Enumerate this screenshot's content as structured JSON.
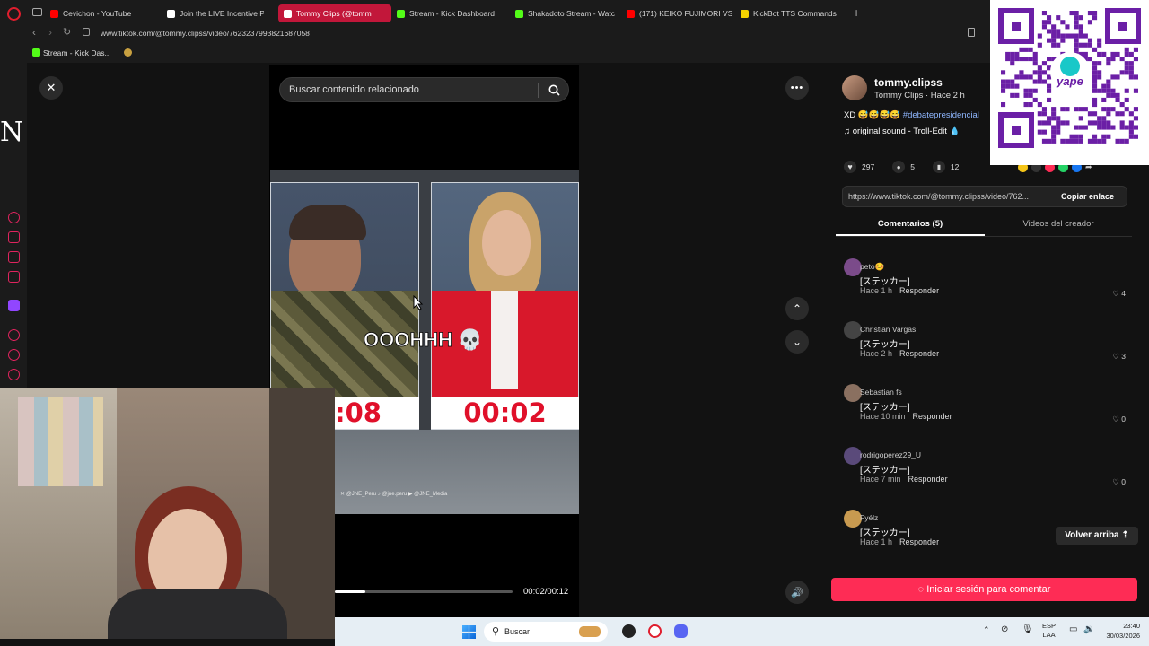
{
  "tabs": [
    {
      "label": "Cevichon - YouTube",
      "fav": "youtube-icon",
      "color": "#ff0000"
    },
    {
      "label": "Join the LIVE Incentive Pr",
      "fav": "tiktok-icon",
      "color": "#ffffff"
    },
    {
      "label": "Tommy Clips (@tomm",
      "fav": "tiktok-icon",
      "color": "#ffffff",
      "active": true
    },
    {
      "label": "Stream - Kick Dashboard",
      "fav": "kick-icon",
      "color": "#53fc18"
    },
    {
      "label": "Shakadoto Stream - Watc",
      "fav": "kick-icon",
      "color": "#53fc18"
    },
    {
      "label": "(171) KEIKO FUJIMORI VS",
      "fav": "youtube-icon",
      "color": "#ff0000"
    },
    {
      "label": "KickBot TTS Commands",
      "fav": "kickbot-icon",
      "color": "#f5d300"
    }
  ],
  "address": {
    "url": "www.tiktok.com/@tommy.clipss/video/7623237993821687058"
  },
  "bookmarks": {
    "item1": "Stream - Kick Das..."
  },
  "search": {
    "placeholder": "Buscar contenido relacionado"
  },
  "video": {
    "caption": "OOOHHH 💀",
    "timer_left": ":08",
    "timer_right": "00:02",
    "time_display": "00:02/00:12",
    "progress": 0.17,
    "footer": "✕ @JNE_Peru   ♪ @jne.peru   ▶ @JNE_Media"
  },
  "sidebar_letter": "N",
  "author": {
    "handle": "tommy.clipss",
    "subtitle": "Tommy Clips · Hace 2 h",
    "caption_prefix": "XD 😅😅😅😅",
    "hashtag": "#debatepresidencial",
    "sound": "original sound - Troll-Edit 💧"
  },
  "stats": {
    "likes": "297",
    "comments": "5",
    "saves": "12"
  },
  "link": {
    "url": "https://www.tiktok.com/@tommy.clipss/video/762...",
    "copy_label": "Copiar enlace"
  },
  "tabs_panel": {
    "comments": "Comentarios (5)",
    "creator": "Videos del creador"
  },
  "comments": [
    {
      "user": "peto🤒",
      "text": "[ステッカー]",
      "time": "Hace 1 h",
      "reply": "Responder",
      "likes": "4",
      "avatar": "#7b4b8a"
    },
    {
      "user": "Christian Vargas",
      "text": "[ステッカー]",
      "time": "Hace 2 h",
      "reply": "Responder",
      "likes": "3",
      "avatar": "#444444"
    },
    {
      "user": "Sebastian fs",
      "text": "[ステッカー]",
      "time": "Hace 10 min",
      "reply": "Responder",
      "likes": "0",
      "avatar": "#8a7060"
    },
    {
      "user": "rodrigoperez29_U",
      "text": "[ステッカー]",
      "time": "Hace 7 min",
      "reply": "Responder",
      "likes": "0",
      "avatar": "#5a4a7a"
    },
    {
      "user": "Fyélz",
      "text": "[ステッカー]",
      "time": "Hace 1 h",
      "reply": "Responder",
      "likes": "",
      "avatar": "#c89a50"
    }
  ],
  "back_top": "Volver arriba ⇡",
  "login_btn": "Iniciar sesión para comentar",
  "taskbar": {
    "search": "Buscar",
    "lang": "ESP",
    "lang2": "LAA",
    "time": "23:40",
    "date": "30/03/2026"
  },
  "colors": {
    "accent": "#fe2c55",
    "tab_active": "#c2173a"
  }
}
